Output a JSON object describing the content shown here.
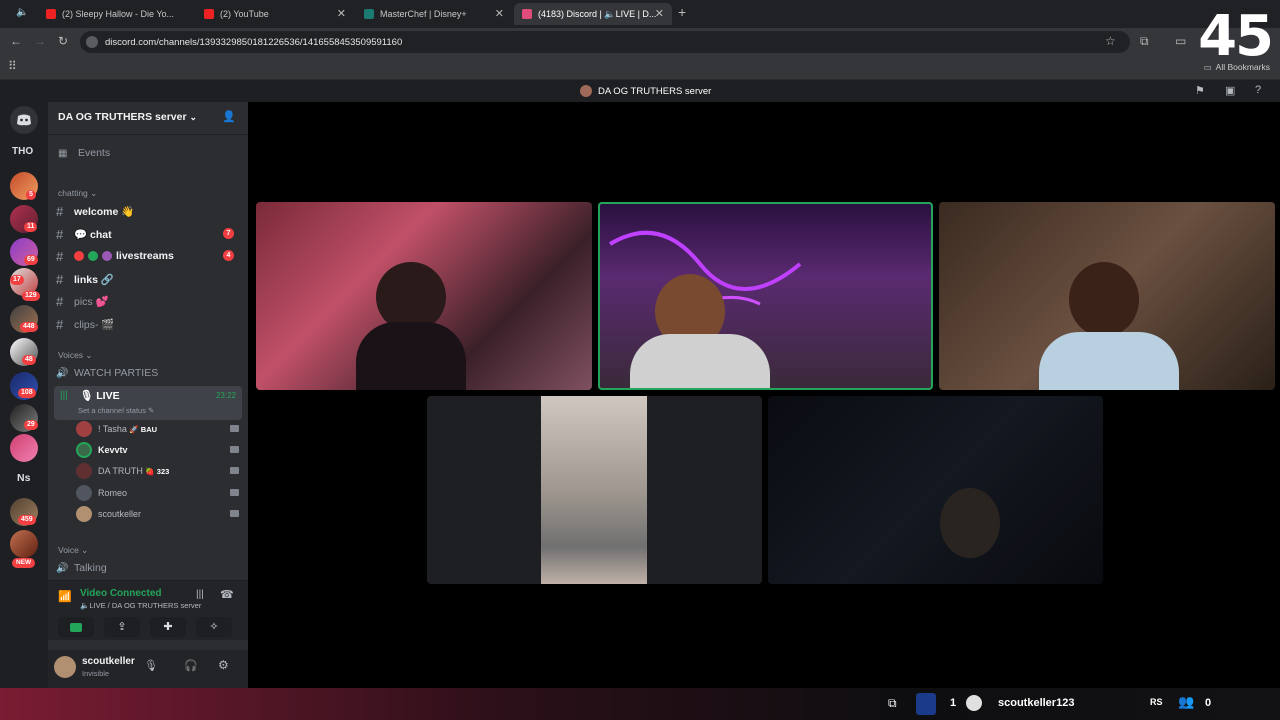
{
  "browser": {
    "tabs": [
      {
        "title": "(2) Sleepy Hallow - Die Yo..."
      },
      {
        "title": "(2) YouTube"
      },
      {
        "title": "MasterChef | Disney+"
      },
      {
        "title": "(4183) Discord | 🔈LIVE | D..."
      }
    ],
    "url": "discord.com/channels/1393329850181226536/1416558453509591160",
    "all_bookmarks": "All Bookmarks",
    "overlay_clock": "45"
  },
  "discord": {
    "window_title": "DA OG TRUTHERS server",
    "guild_badges": [
      "5",
      "11",
      "69",
      "17",
      "129",
      "448",
      "48",
      "108",
      "29",
      "459"
    ],
    "guild_labels": {
      "tho": "THO",
      "ns": "Ns",
      "new": "NEW"
    },
    "server": {
      "name": "DA OG TRUTHERS server",
      "events": "Events",
      "cat_chatting": "chatting",
      "channels": [
        {
          "name": "welcome 👋",
          "unread": ""
        },
        {
          "name": "💬 chat",
          "unread": "7"
        },
        {
          "name": "livestreams",
          "unread": "4"
        },
        {
          "name": "links 🔗",
          "unread": ""
        },
        {
          "name": "pics 💕",
          "unread": ""
        },
        {
          "name": "clips- 🎬",
          "unread": ""
        }
      ],
      "cat_voices": "Voices",
      "watch_parties": "WATCH PARTIES",
      "live": {
        "name": "LIVE",
        "timer": "23:22",
        "status": "Set a channel status"
      },
      "members": [
        {
          "name": "! Tasha",
          "tag": "🚀 BAU"
        },
        {
          "name": "Kevvtv",
          "tag": ""
        },
        {
          "name": "DA TRUTH",
          "tag": "🍓 323"
        },
        {
          "name": "Romeo",
          "tag": ""
        },
        {
          "name": "scoutkeller",
          "tag": ""
        }
      ],
      "cat_voice": "Voice",
      "talking": "Talking"
    },
    "voice_panel": {
      "status": "Video Connected",
      "location": "LIVE / DA OG TRUTHERS server"
    },
    "user": {
      "name": "scoutkeller",
      "status": "Invisible"
    }
  },
  "taskbar": {
    "username": "scoutkeller123",
    "count": "1",
    "zero": "0",
    "rs": "RS"
  }
}
